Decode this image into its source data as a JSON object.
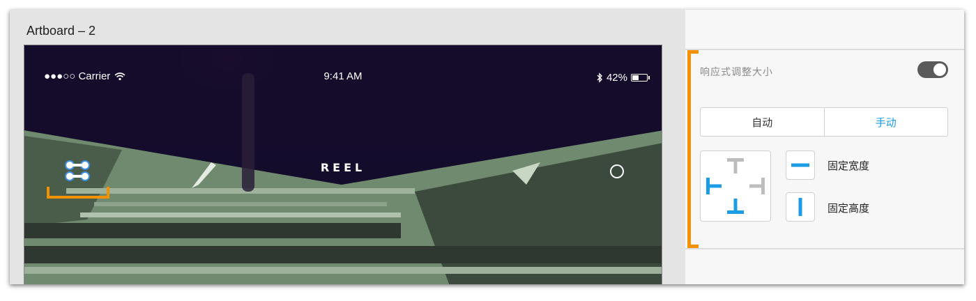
{
  "canvas": {
    "artboard_title": "Artboard – 2",
    "status_bar": {
      "carrier": "●●●○○ Carrier",
      "time": "9:41 AM",
      "battery": "42%",
      "battery_level": 0.42
    },
    "nav_title": "REEL"
  },
  "panel": {
    "responsive_resize_label": "响应式调整大小",
    "responsive_resize_on": true,
    "mode_tabs": [
      {
        "label": "自动",
        "active": false
      },
      {
        "label": "手动",
        "active": true
      }
    ],
    "fixed_width_label": "固定宽度",
    "fixed_height_label": "固定高度"
  },
  "colors": {
    "accent_orange": "#f39200",
    "active_blue": "#1b9ce5",
    "pin_inactive_gray": "#bdbdbd"
  },
  "icons": [
    "wifi-icon",
    "bluetooth-icon",
    "battery-icon",
    "menu-icon",
    "circle-icon",
    "pin-top-icon",
    "pin-left-icon",
    "pin-right-icon",
    "pin-bottom-icon",
    "fixed-width-icon",
    "fixed-height-icon"
  ]
}
